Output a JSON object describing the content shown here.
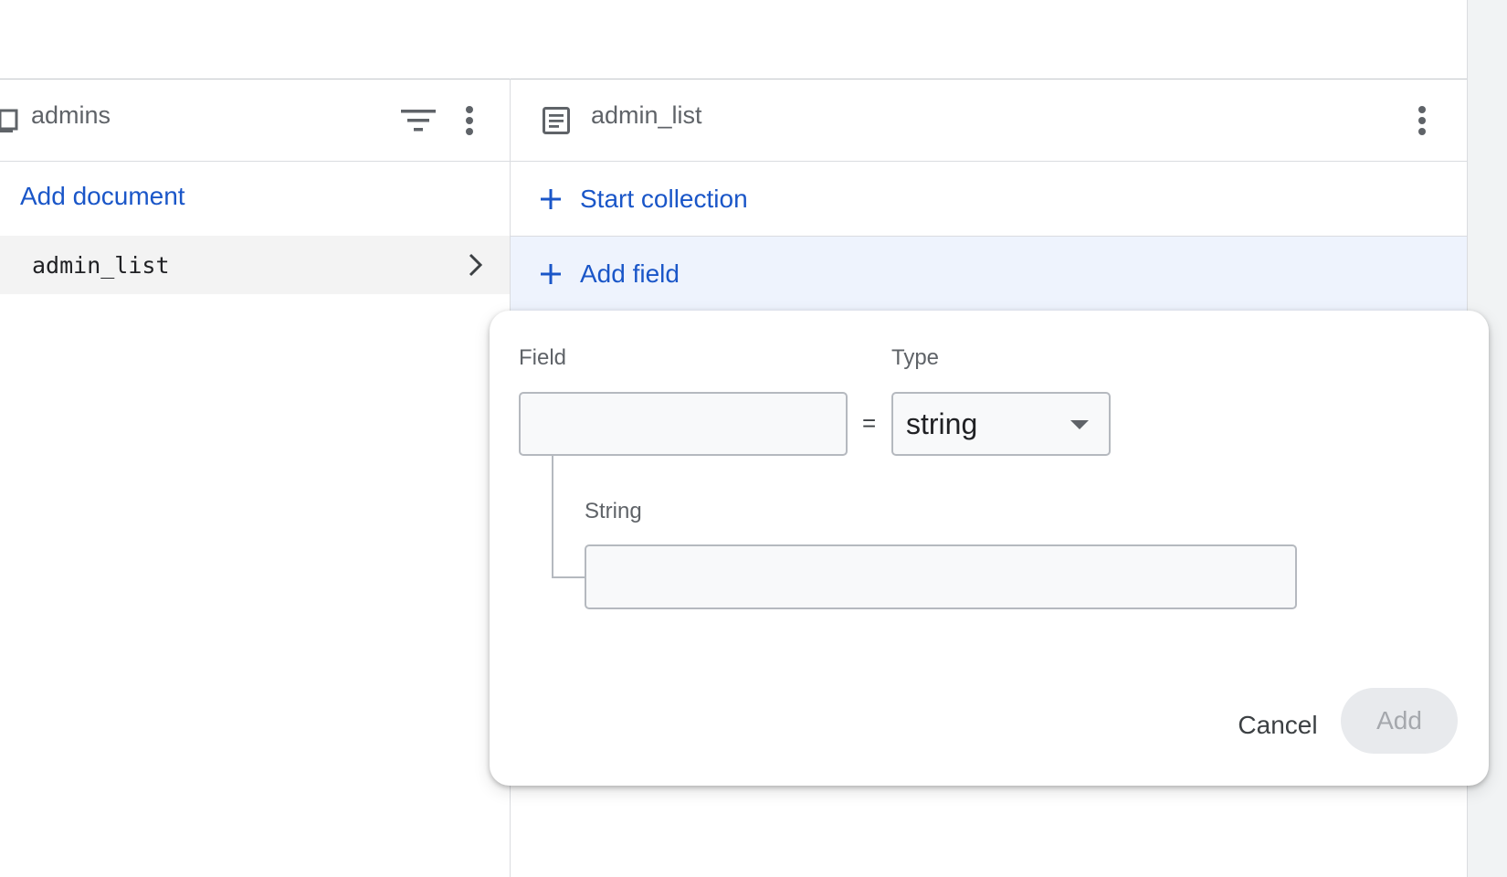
{
  "columns": {
    "collection": {
      "title": "admins",
      "add_document_label": "Add document",
      "documents": [
        {
          "label": "admin_list"
        }
      ]
    },
    "document": {
      "title": "admin_list",
      "start_collection_label": "Start collection",
      "add_field_label": "Add field"
    }
  },
  "add_field_form": {
    "field_label": "Field",
    "field_value": "",
    "type_label": "Type",
    "equals_sign": "=",
    "type_value": "string",
    "value_label": "String",
    "value_value": "",
    "cancel_label": "Cancel",
    "add_label": "Add"
  },
  "colors": {
    "link_blue": "#1a56c8",
    "add_field_row_bg": "#eef3fd",
    "selected_row_bg": "#f3f3f3",
    "disabled_button_bg": "#e8eaed"
  },
  "icons": [
    "collection-icon",
    "filter-icon",
    "more-vert-icon",
    "document-icon",
    "chevron-right-icon",
    "plus-icon",
    "dropdown-caret-icon"
  ]
}
